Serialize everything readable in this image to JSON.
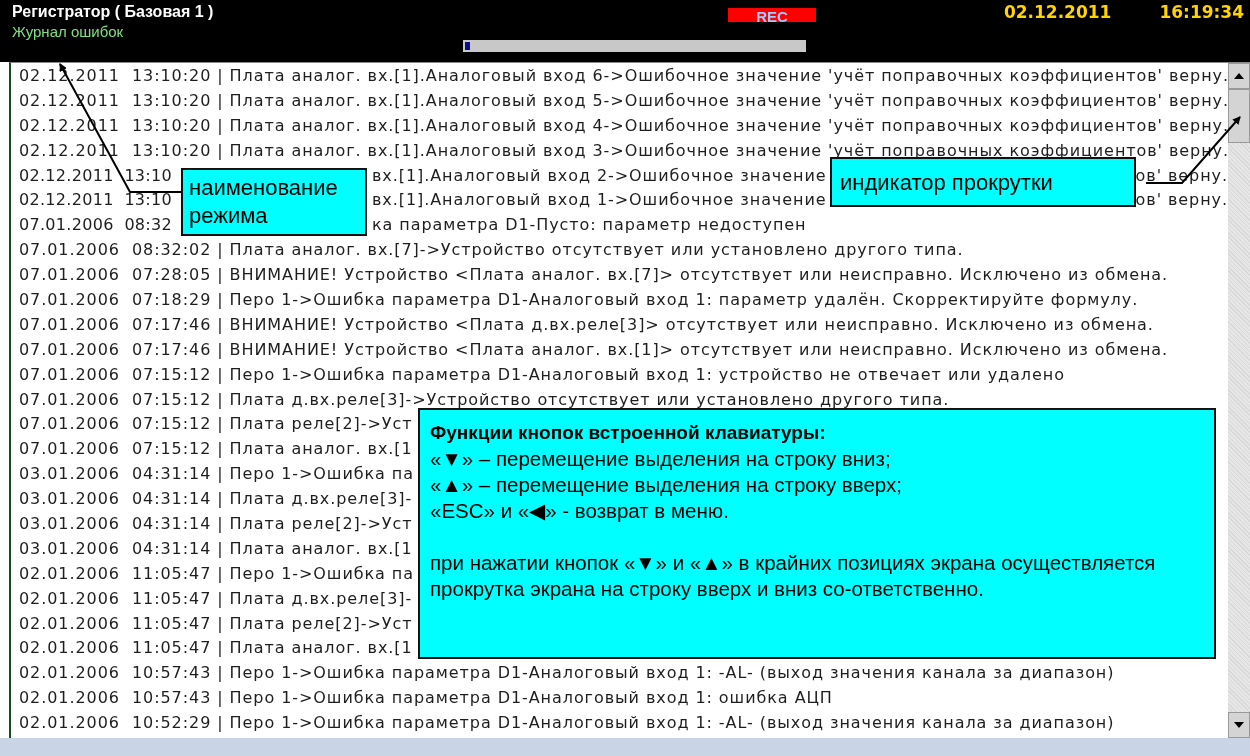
{
  "header": {
    "title": "Регистратор ( Базовая 1 )",
    "mode": "Журнал ошибок",
    "rec_label": "REC",
    "date": "02.12.2011",
    "time": "16:19:34",
    "position": {
      "level": 0.025
    }
  },
  "log": {
    "rows": [
      {
        "text": "02.12.2011  13:10:20 | Плата аналог. вх.[1].Аналоговый вход 6->Ошибочное значение 'учёт поправочных коэффициентов' верну."
      },
      {
        "text": "02.12.2011  13:10:20 | Плата аналог. вх.[1].Аналоговый вход 5->Ошибочное значение 'учёт поправочных коэффициентов' верну."
      },
      {
        "text": "02.12.2011  13:10:20 | Плата аналог. вх.[1].Аналоговый вход 4->Ошибочное значение 'учёт поправочных коэффициентов' верну."
      },
      {
        "text": "02.12.2011  13:10:20 | Плата аналог. вх.[1].Аналоговый вход 3->Ошибочное значение 'учёт поправочных коэффициентов' верну."
      },
      {
        "parts": [
          {
            "kind": "lead",
            "text": "02.12.2011  13:10"
          },
          {
            "kind": "mid",
            "text": "вх.[1].Аналоговый вход 2->Ошибочное значение"
          },
          {
            "kind": "tail",
            "text": "ов' верну."
          }
        ]
      },
      {
        "parts": [
          {
            "kind": "lead",
            "text": "02.12.2011  13:10"
          },
          {
            "kind": "mid",
            "text": "вх.[1].Аналоговый вход 1->Ошибочное значение"
          },
          {
            "kind": "tail",
            "text": "ов' верну."
          }
        ]
      },
      {
        "parts": [
          {
            "kind": "lead",
            "text": "07.01.2006  08:32"
          },
          {
            "kind": "mid",
            "text": "ка параметра D1-Пусто: параметр недоступен"
          }
        ]
      },
      {
        "text": "07.01.2006  08:32:02 | Плата аналог. вх.[7]->Устройство отсутствует или установлено другого типа."
      },
      {
        "text": "07.01.2006  07:28:05 | ВНИМАНИЕ! Устройство <Плата аналог. вх.[7]> отсутствует или неисправно. Исключено из обмена."
      },
      {
        "text": "07.01.2006  07:18:29 | Перо 1->Ошибка параметра D1-Аналоговый вход 1: параметр удалён. Скорректируйте формулу."
      },
      {
        "text": "07.01.2006  07:17:46 | ВНИМАНИЕ! Устройство <Плата д.вх.реле[3]> отсутствует или неисправно. Исключено из обмена."
      },
      {
        "text": "07.01.2006  07:17:46 | ВНИМАНИЕ! Устройство <Плата аналог. вх.[1]> отсутствует или неисправно. Исключено из обмена."
      },
      {
        "text": "07.01.2006  07:15:12 | Перо 1->Ошибка параметра D1-Аналоговый вход 1: устройство не отвечает или удалено"
      },
      {
        "text": "07.01.2006  07:15:12 | Плата д.вх.реле[3]->Устройство отсутствует или установлено другого типа."
      },
      {
        "text": "07.01.2006  07:15:12 | Плата реле[2]->Уст"
      },
      {
        "text": "07.01.2006  07:15:12 | Плата аналог. вх.[1"
      },
      {
        "text": "03.01.2006  04:31:14 | Перо 1->Ошибка па"
      },
      {
        "text": "03.01.2006  04:31:14 | Плата д.вх.реле[3]-"
      },
      {
        "text": "03.01.2006  04:31:14 | Плата реле[2]->Уст"
      },
      {
        "text": "03.01.2006  04:31:14 | Плата аналог. вх.[1"
      },
      {
        "text": "02.01.2006  11:05:47 | Перо 1->Ошибка па"
      },
      {
        "text": "02.01.2006  11:05:47 | Плата д.вх.реле[3]-"
      },
      {
        "text": "02.01.2006  11:05:47 | Плата реле[2]->Уст"
      },
      {
        "text": "02.01.2006  11:05:47 | Плата аналог. вх.[1"
      },
      {
        "text": "02.01.2006  10:57:43 | Перо 1->Ошибка параметра D1-Аналоговый вход 1: -AL- (выход значения канала за диапазон)"
      },
      {
        "text": "02.01.2006  10:57:43 | Перо 1->Ошибка параметра D1-Аналоговый вход 1: ошибка АЦП"
      },
      {
        "text": "02.01.2006  10:52:29 | Перо 1->Ошибка параметра D1-Аналоговый вход 1: -AL- (выход значения канала за диапазон)"
      }
    ]
  },
  "callouts": [
    {
      "kind": "mode",
      "text": "наименование режима"
    },
    {
      "kind": "scroll",
      "text": "индикатор прокрутки"
    },
    {
      "kind": "help",
      "title": "Функции кнопок встроенной клавиатуры:",
      "lines": [
        "«▼» – перемещение выделения на строку вниз;",
        "«▲» – перемещение выделения на строку вверх;",
        "«ESC» и «◀» - возврат в меню."
      ],
      "note": "при нажатии кнопок «▼» и «▲» в крайних позициях экрана осуществляется прокрутка экрана на строку вверх и вниз со-ответственно."
    }
  ]
}
